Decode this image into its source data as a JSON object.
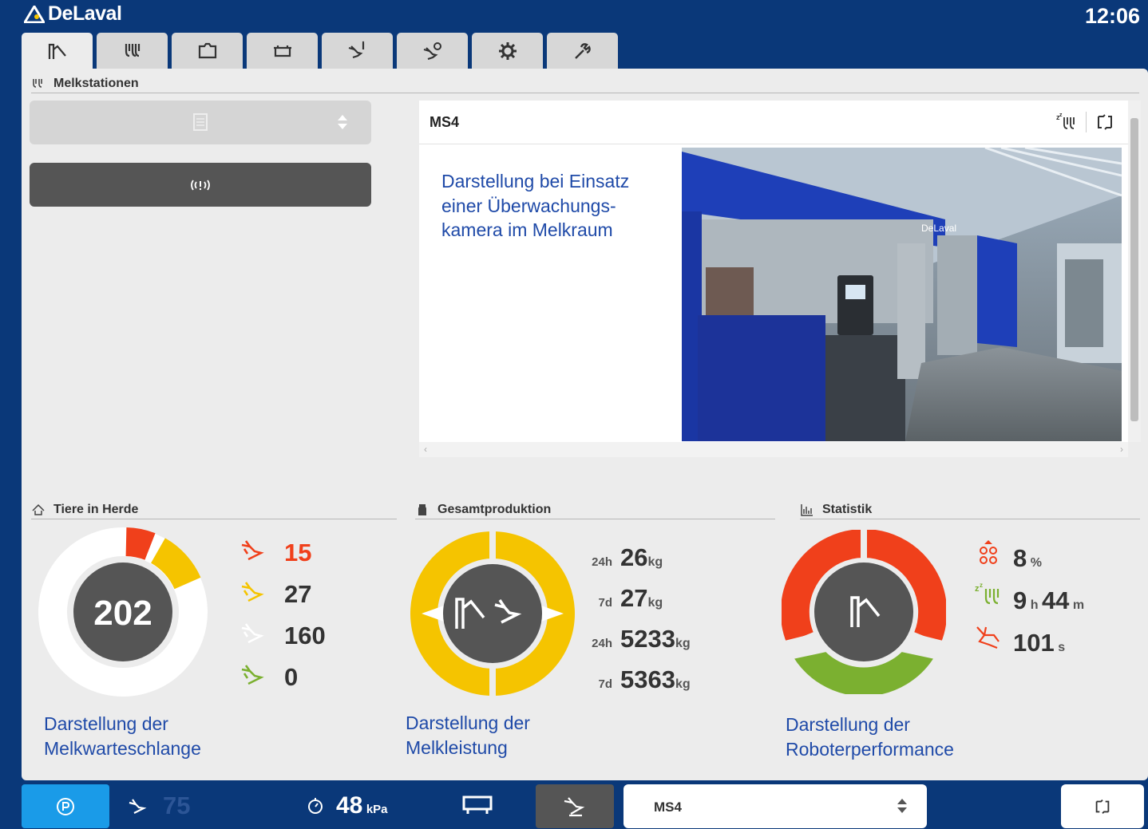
{
  "header": {
    "brand": "DeLaval",
    "clock": "12:06"
  },
  "tabs": [
    {
      "icon": "milking-robot-icon"
    },
    {
      "icon": "milking-station-icon"
    },
    {
      "icon": "feed-trough-icon"
    },
    {
      "icon": "cleaning-tub-icon"
    },
    {
      "icon": "cow-info-icon"
    },
    {
      "icon": "cow-search-icon"
    },
    {
      "icon": "settings-gear-icon"
    },
    {
      "icon": "service-wrench-icon"
    }
  ],
  "melkstationen": {
    "title": "Melkstationen",
    "card": {
      "title": "MS4",
      "caption": "Darstellung bei Einsatz einer Überwachungs-kamera im Melkraum",
      "image_logo": "DeLaval"
    }
  },
  "herd": {
    "title": "Tiere in Herde",
    "total": "202",
    "items": [
      {
        "value": "15",
        "color": "#f0401b"
      },
      {
        "value": "27",
        "color": "#f5c400"
      },
      {
        "value": "160",
        "color": "#ffffff"
      },
      {
        "value": "0",
        "color": "#7bb030"
      }
    ],
    "caption_line1": "Darstellung der",
    "caption_line2": "Melkwarteschlange"
  },
  "production": {
    "title": "Gesamtproduktion",
    "rows": [
      {
        "period": "24h",
        "value": "26",
        "unit": "kg"
      },
      {
        "period": "7d",
        "value": "27",
        "unit": "kg"
      },
      {
        "period": "24h",
        "value": "5233",
        "unit": "kg"
      },
      {
        "period": "7d",
        "value": "5363",
        "unit": "kg"
      }
    ],
    "caption_line1": "Darstellung der",
    "caption_line2": "Melkleistung"
  },
  "statistik": {
    "title": "Statistik",
    "rows": [
      {
        "value": "8",
        "unit": "%"
      },
      {
        "value_h": "9",
        "unit_h": "h",
        "value_m": "44",
        "unit_m": "m"
      },
      {
        "value": "101",
        "unit": "s"
      }
    ],
    "caption_line1": "Darstellung der",
    "caption_line2": "Roboterperformance"
  },
  "footer": {
    "cows_waiting": "75",
    "vacuum_value": "48",
    "vacuum_unit": "kPa",
    "station_select": "MS4"
  },
  "colors": {
    "brand_blue": "#0a3879",
    "panel": "#ececec",
    "red": "#f0401b",
    "yellow": "#f5c400",
    "green": "#7bb030",
    "dark": "#555555",
    "accent_blue": "#1a9be8"
  }
}
